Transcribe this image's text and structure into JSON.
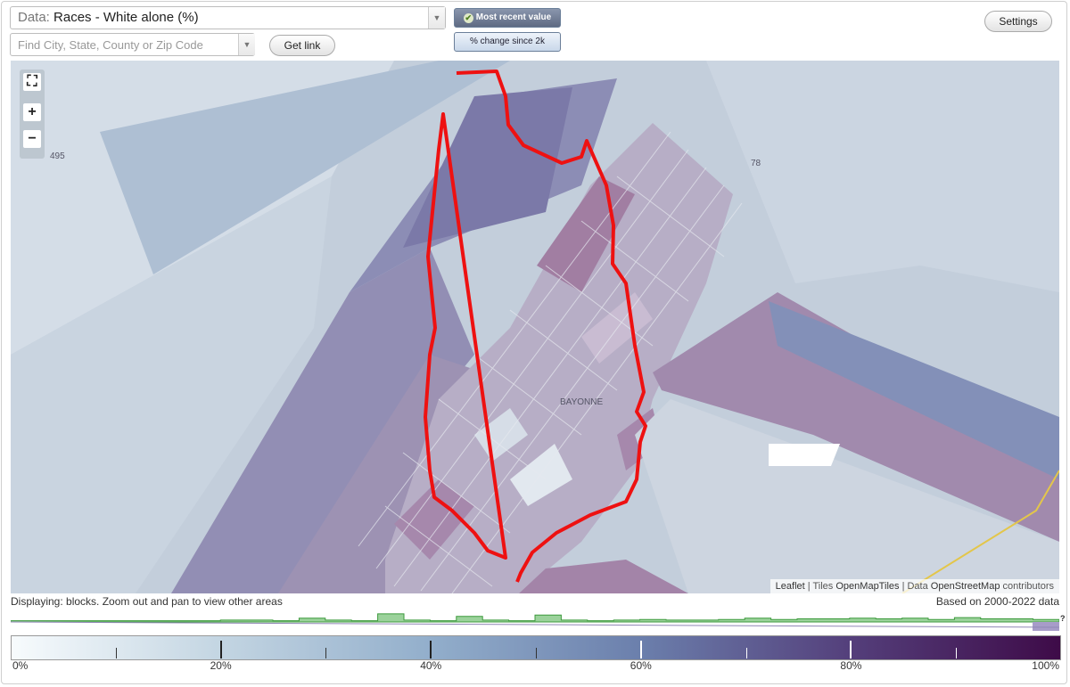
{
  "toolbar": {
    "data_prefix": "Data:",
    "data_value": "Races - White alone (%)",
    "search_placeholder": "Find City, State, County or Zip Code",
    "get_link_label": "Get link",
    "mode_recent_label": "Most recent value",
    "mode_change_label": "% change since 2k",
    "settings_label": "Settings"
  },
  "map": {
    "place_label": "BAYONNE",
    "road_labels": [
      "495",
      "78"
    ],
    "attribution": {
      "leaflet": "Leaflet",
      "sep": "|",
      "tiles_prefix": "Tiles",
      "tiles_link": "OpenMapTiles",
      "data_prefix": "Data",
      "data_link": "OpenStreetMap",
      "data_suffix": "contributors"
    },
    "boundary_color": "#ee1111"
  },
  "status": {
    "displaying": "Displaying: blocks. Zoom out and pan to view other areas",
    "based_on": "Based on 2000-2022 data",
    "help": "?"
  },
  "histogram": {
    "color": "#9bd29b",
    "bins": [
      0.1,
      0.1,
      0.1,
      0.1,
      0.1,
      0.1,
      0.1,
      0.1,
      0.15,
      0.15,
      0.1,
      0.3,
      0.15,
      0.1,
      0.65,
      0.15,
      0.1,
      0.45,
      0.15,
      0.1,
      0.55,
      0.15,
      0.1,
      0.15,
      0.2,
      0.15,
      0.15,
      0.2,
      0.3,
      0.2,
      0.25,
      0.25,
      0.3,
      0.25,
      0.3,
      0.2,
      0.35,
      0.25,
      0.25,
      0.2
    ]
  },
  "legend": {
    "labels": [
      "0%",
      "20%",
      "40%",
      "60%",
      "80%",
      "100%"
    ],
    "colors": [
      "#f7fbfd",
      "#c3d5e2",
      "#92aecb",
      "#6b7fac",
      "#543f7b",
      "#3e0b48"
    ]
  }
}
